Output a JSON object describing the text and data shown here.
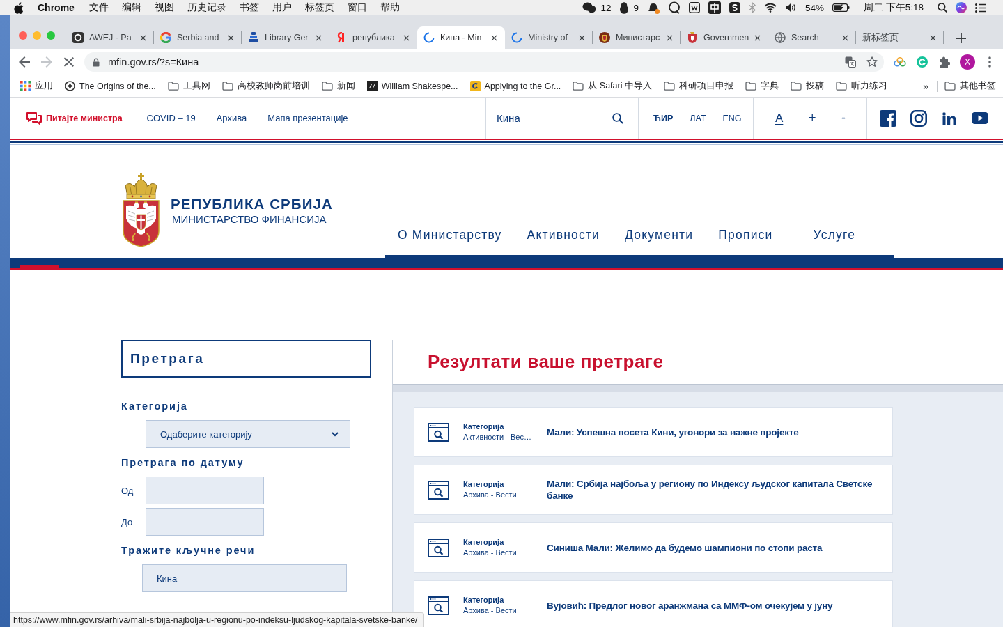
{
  "menu_bar": {
    "app": "Chrome",
    "menus": [
      "文件",
      "编辑",
      "视图",
      "历史记录",
      "书签",
      "用户",
      "标签页",
      "窗口",
      "帮助"
    ],
    "chat_badge": "12",
    "penguin_badge": "9",
    "battery": "54%",
    "clock": "周二 下午5:18"
  },
  "tabs": [
    {
      "title": "AWEJ - Pa",
      "selected": false,
      "loading": false
    },
    {
      "title": "Serbia and",
      "selected": false,
      "loading": false
    },
    {
      "title": "Library Ger",
      "selected": false,
      "loading": false
    },
    {
      "title": "република",
      "selected": false,
      "loading": false
    },
    {
      "title": "Кина - Min",
      "selected": true,
      "loading": true
    },
    {
      "title": "Ministry of",
      "selected": false,
      "loading": true
    },
    {
      "title": "Министарс",
      "selected": false,
      "loading": false
    },
    {
      "title": "Governmen",
      "selected": false,
      "loading": false
    },
    {
      "title": "Search",
      "selected": false,
      "loading": false
    },
    {
      "title": "新标签页",
      "selected": false,
      "loading": false
    }
  ],
  "toolbar": {
    "nav_buttons": [
      {
        "kind": "back",
        "disabled": false
      },
      {
        "kind": "forward",
        "disabled": true
      },
      {
        "kind": "stop",
        "disabled": false
      }
    ],
    "url": "mfin.gov.rs/?s=Кина",
    "profile": "X"
  },
  "bookmarks": {
    "items": [
      {
        "label": "应用",
        "kind": "apps"
      },
      {
        "label": "The Origins of the...",
        "kind": "site"
      },
      {
        "label": "工具网",
        "kind": "folder"
      },
      {
        "label": "高校教师岗前培训",
        "kind": "folder"
      },
      {
        "label": "新闻",
        "kind": "folder"
      },
      {
        "label": "William Shakespe...",
        "kind": "site"
      },
      {
        "label": "Applying to the Gr...",
        "kind": "site"
      },
      {
        "label": "从 Safari 中导入",
        "kind": "folder"
      },
      {
        "label": "科研项目申报",
        "kind": "folder"
      },
      {
        "label": "字典",
        "kind": "folder"
      },
      {
        "label": "投稿",
        "kind": "folder"
      },
      {
        "label": "听力练习",
        "kind": "folder"
      }
    ],
    "overflow": "»",
    "other": "其他书签"
  },
  "site_top": {
    "ask": "Питајте министра",
    "links": [
      "COVID – 19",
      "Архива",
      "Мапа презентације"
    ],
    "search": {
      "value": "Кина"
    },
    "languages": [
      {
        "label": "ЋИР",
        "selected": true
      },
      {
        "label": "ЛАТ",
        "selected": false
      },
      {
        "label": "ENG",
        "selected": false
      }
    ],
    "font_controls": [
      {
        "label": "A",
        "kind": "reset"
      },
      {
        "label": "+",
        "kind": "increase"
      },
      {
        "label": "-",
        "kind": "decrease"
      }
    ]
  },
  "header": {
    "title": "РЕПУБЛИКА СРБИЈА",
    "subtitle": "МИНИСТАРСТВО ФИНАНСИЈА",
    "nav": [
      "О Министарству",
      "Активности",
      "Документи",
      "Прописи",
      "Услуге"
    ]
  },
  "sidebar": {
    "heading": "Претрага",
    "category_label": "Категорија",
    "category_select": {
      "value": "Одаберите категорију"
    },
    "date_label": "Претрага по датуму",
    "date_fields": [
      {
        "label": "Од"
      },
      {
        "label": "До"
      }
    ],
    "keywords_label": "Тражите кључне речи",
    "keywords_field": {
      "value": "Кина"
    }
  },
  "results": {
    "title": "Резултати ваше претраге",
    "items": [
      {
        "label": "Категорија",
        "category": "Активности - Вес…",
        "title": "Мали: Успешна посета Кини, уговори за важне пројекте"
      },
      {
        "label": "Категорија",
        "category": "Архива - Вести",
        "title": "Мали: Србија најбоља у региону по Индексу људског капитала Светске банке"
      },
      {
        "label": "Категорија",
        "category": "Архива - Вести",
        "title": "Синиша Мали: Желимо да будемо шампиони по стопи раста"
      },
      {
        "label": "Категорија",
        "category": "Архива - Вести",
        "title": "Вујовић: Предлог новог аранжмана са ММФ-ом очекујем у јуну"
      }
    ]
  },
  "status_url": "https://www.mfin.gov.rs/arhiva/mali-srbija-najbolja-u-regionu-po-indeksu-ljudskog-kapitala-svetske-banke/"
}
